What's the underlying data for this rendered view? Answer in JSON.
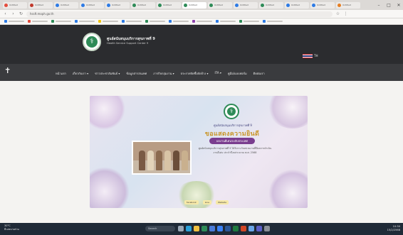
{
  "browser": {
    "tabs": [
      {
        "label": "Untitled",
        "color": "#e44c3c"
      },
      {
        "label": "Untitled",
        "color": "#c0392b"
      },
      {
        "label": "Untitled",
        "color": "#2d7be5"
      },
      {
        "label": "Untitled",
        "color": "#2d7be5"
      },
      {
        "label": "Untitled",
        "color": "#2d7be5"
      },
      {
        "label": "Untitled",
        "color": "#2e8b57"
      },
      {
        "label": "Untitled",
        "color": "#2e8b57"
      },
      {
        "label": "Untitled",
        "color": "#2e8b57",
        "active": true
      },
      {
        "label": "Untitled",
        "color": "#2e8b57"
      },
      {
        "label": "Untitled",
        "color": "#2d7be5"
      },
      {
        "label": "Untitled",
        "color": "#2e8b57"
      },
      {
        "label": "Untitled",
        "color": "#2d7be5"
      },
      {
        "label": "Untitled",
        "color": "#2d7be5"
      },
      {
        "label": "Untitled",
        "color": "#e67e22"
      }
    ],
    "url": "hss9.moph.go.th",
    "bookmarks": [
      {
        "color": "#2d7be5"
      },
      {
        "color": "#e44c3c"
      },
      {
        "color": "#2e8b57"
      },
      {
        "color": "#2d7be5"
      },
      {
        "color": "#f1c40f"
      },
      {
        "color": "#2d7be5"
      },
      {
        "color": "#2e8b57"
      },
      {
        "color": "#2d7be5"
      },
      {
        "color": "#8e44ad"
      },
      {
        "color": "#2d7be5"
      },
      {
        "color": "#2e8b57"
      },
      {
        "color": "#2d7be5"
      }
    ]
  },
  "site": {
    "name": "ศูนย์สนับสนุนบริการสุขภาพที่ 9",
    "subtitle": "Health Service Support Center 9",
    "language": "TH"
  },
  "menu": [
    "หน้าแรก",
    "เกี่ยวกับเรา ▾",
    "ข่าวประชาสัมพันธ์ ▾",
    "ข้อมูลสารสนเทศ",
    "ภารกิจกลุ่มงาน ▾",
    "ประกาศจัดซื้อจัดจ้าง ▾",
    "ITA ▾",
    "คู่มือ/แบบฟอร์ม",
    "ติดต่อเรา"
  ],
  "banner": {
    "org": "ศูนย์สนับสนุนบริการสุขภาพที่ 9",
    "title": "ขอแสดงความยินดี",
    "pill": "ผลงานดีเด่นระดับประเทศ",
    "text": "ศูนย์สนับสนุนบริการสุขภาพที่ 9 ได้รับรางวัลหน่วยงานที่มีผลการดำเนินงานดีเด่น ประจำปีงบประมาณ พ.ศ. 2568",
    "footer_links": [
      "facebook",
      "Line",
      "Website"
    ]
  },
  "taskbar": {
    "weather_temp": "30°C",
    "weather_text": "มีเมฆบางส่วน",
    "search_placeholder": "Search",
    "time": "10:30",
    "date": "15/2/2568",
    "icons": [
      {
        "name": "task-view",
        "color": "#9aa7b5"
      },
      {
        "name": "edge",
        "color": "#2aa0d8"
      },
      {
        "name": "file-explorer",
        "color": "#f0c040"
      },
      {
        "name": "chrome",
        "color": "#2e8b57"
      },
      {
        "name": "store",
        "color": "#4a7bd8"
      },
      {
        "name": "mail",
        "color": "#3b82f6"
      },
      {
        "name": "word",
        "color": "#2b5797"
      },
      {
        "name": "excel",
        "color": "#1f7a3f"
      },
      {
        "name": "powerpoint",
        "color": "#d24726"
      },
      {
        "name": "photos",
        "color": "#6aa6e8"
      },
      {
        "name": "teams",
        "color": "#5b5fc7"
      },
      {
        "name": "settings",
        "color": "#8a8f96"
      }
    ]
  }
}
